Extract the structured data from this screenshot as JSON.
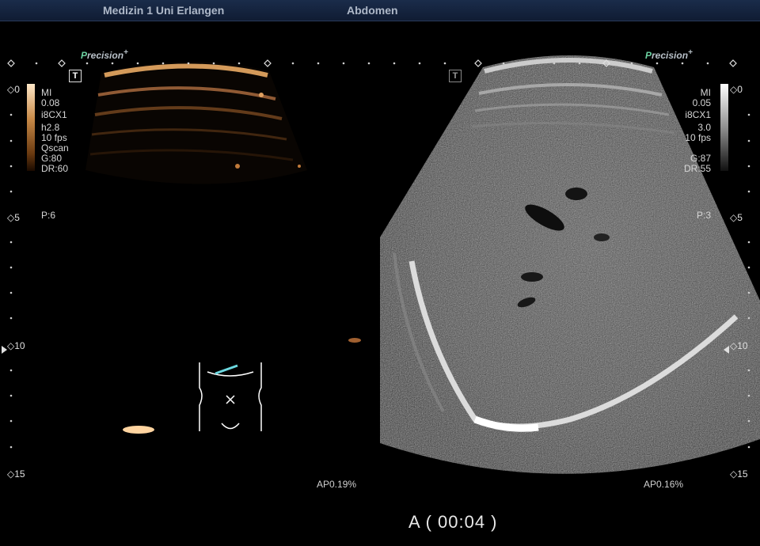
{
  "header": {
    "institution": "Medizin 1 Uni Erlangen",
    "exam": "Abdomen"
  },
  "brand": {
    "prefix": "P",
    "rest": "recision",
    "plus": "+"
  },
  "left_panel": {
    "mode_icon": "T",
    "params": [
      "MI",
      "0.08",
      "i8CX1",
      "h2.8",
      "10 fps",
      "Qscan",
      "G:80",
      "DR:60"
    ],
    "persistence": "P:6",
    "acoustic_power": "AP0.19%",
    "colormap": [
      "#1a0a00",
      "#6a3a10",
      "#c88a48",
      "#ffe8c8"
    ]
  },
  "right_panel": {
    "mode_icon": "T",
    "params": [
      "MI",
      "0.05",
      "i8CX1",
      "3.0",
      "10 fps",
      "",
      "G:87",
      "DR:55"
    ],
    "persistence": "P:3",
    "acoustic_power": "AP0.16%",
    "colormap": [
      "#101010",
      "#606060",
      "#b0b0b0",
      "#ffffff"
    ]
  },
  "depth_marks": [
    "0",
    "5",
    "10",
    "15"
  ],
  "status": {
    "timer": "A ( 00:04 )"
  }
}
